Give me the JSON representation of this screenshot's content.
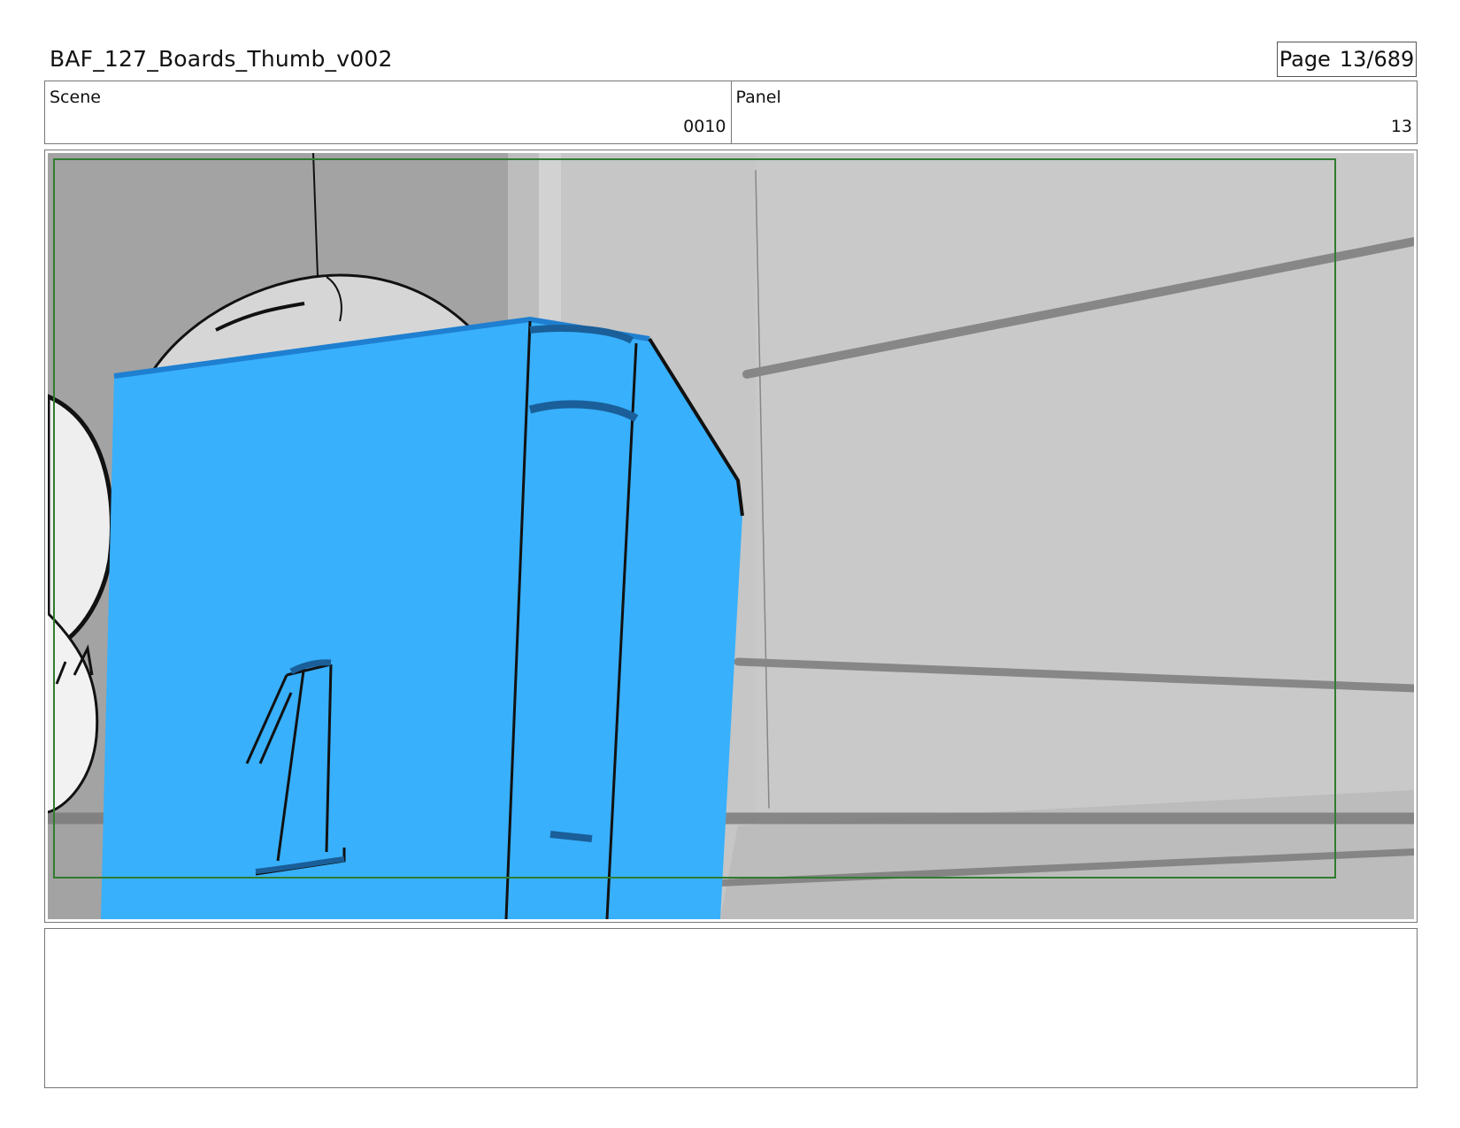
{
  "document": {
    "title": "BAF_127_Boards_Thumb_v002",
    "page_label": "Page",
    "page_number": "13/689"
  },
  "info": {
    "scene_label": "Scene",
    "scene_value": "0010",
    "panel_label": "Panel",
    "panel_value": "13"
  },
  "panel_image": {
    "colors": {
      "safe_frame": "#2f7d2f",
      "box_fill": "#38b0fc",
      "wall": "#c6c6c6",
      "dark_wall": "#a3a3a3"
    }
  },
  "notes": {
    "text": ""
  }
}
